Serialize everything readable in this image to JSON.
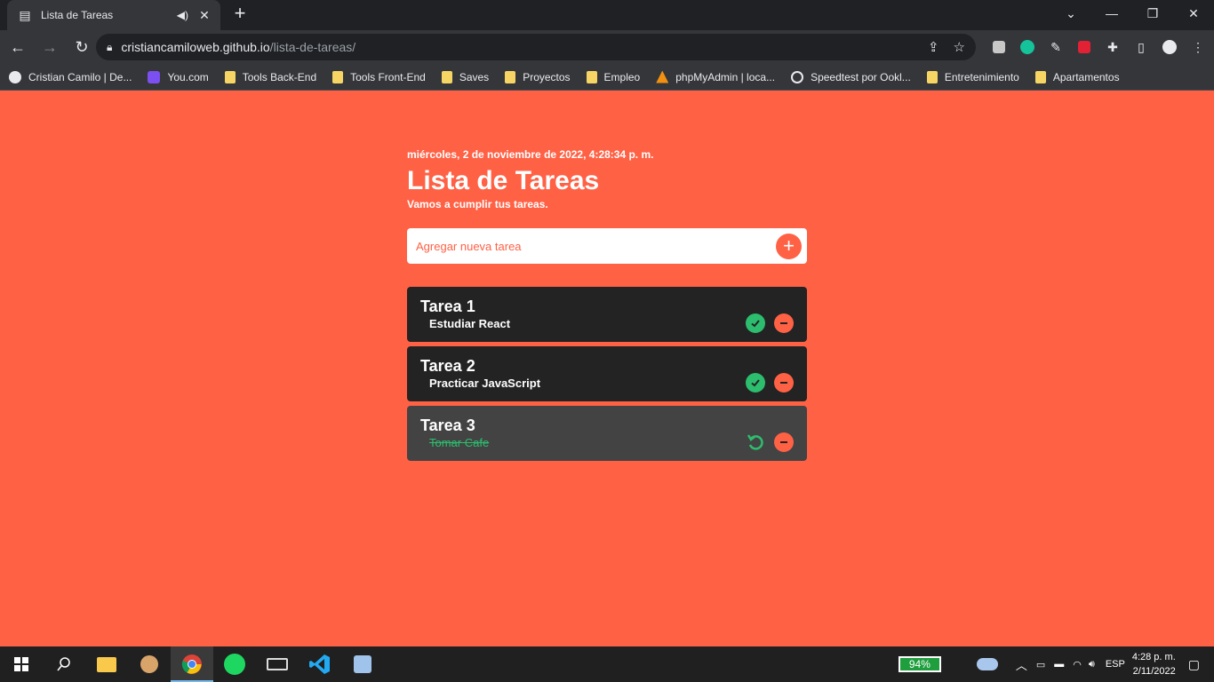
{
  "browser": {
    "tab_title": "Lista de Tareas",
    "url_host": "cristiancamiloweb.github.io",
    "url_path": "/lista-de-tareas/"
  },
  "bookmarks": [
    {
      "label": "Cristian Camilo | De...",
      "icon": "github-icon"
    },
    {
      "label": "You.com",
      "icon": "you-icon"
    },
    {
      "label": "Tools Back-End",
      "icon": "folder-icon"
    },
    {
      "label": "Tools Front-End",
      "icon": "folder-icon"
    },
    {
      "label": "Saves",
      "icon": "folder-icon"
    },
    {
      "label": "Proyectos",
      "icon": "folder-icon"
    },
    {
      "label": "Empleo",
      "icon": "folder-icon"
    },
    {
      "label": "phpMyAdmin | loca...",
      "icon": "phpmyadmin-icon"
    },
    {
      "label": "Speedtest por Ookl...",
      "icon": "speedtest-icon"
    },
    {
      "label": "Entretenimiento",
      "icon": "folder-icon"
    },
    {
      "label": "Apartamentos",
      "icon": "folder-icon"
    }
  ],
  "app": {
    "date": "miércoles, 2 de noviembre de 2022, 4:28:34 p. m.",
    "title": "Lista de Tareas",
    "subtitle": "Vamos a cumplir tus tareas.",
    "input_placeholder": "Agregar nueva tarea",
    "tasks": [
      {
        "title": "Tarea 1",
        "description": "Estudiar React",
        "done": false
      },
      {
        "title": "Tarea 2",
        "description": "Practicar JavaScript",
        "done": false
      },
      {
        "title": "Tarea 3",
        "description": "Tomar Cafe",
        "done": true
      }
    ]
  },
  "taskbar": {
    "battery": "94%",
    "language": "ESP",
    "time": "4:28 p. m.",
    "date": "2/11/2022"
  },
  "colors": {
    "background": "#ff6145",
    "task_bg": "#232323",
    "task_done_bg": "#434343",
    "check_green": "#2dbd6e"
  }
}
